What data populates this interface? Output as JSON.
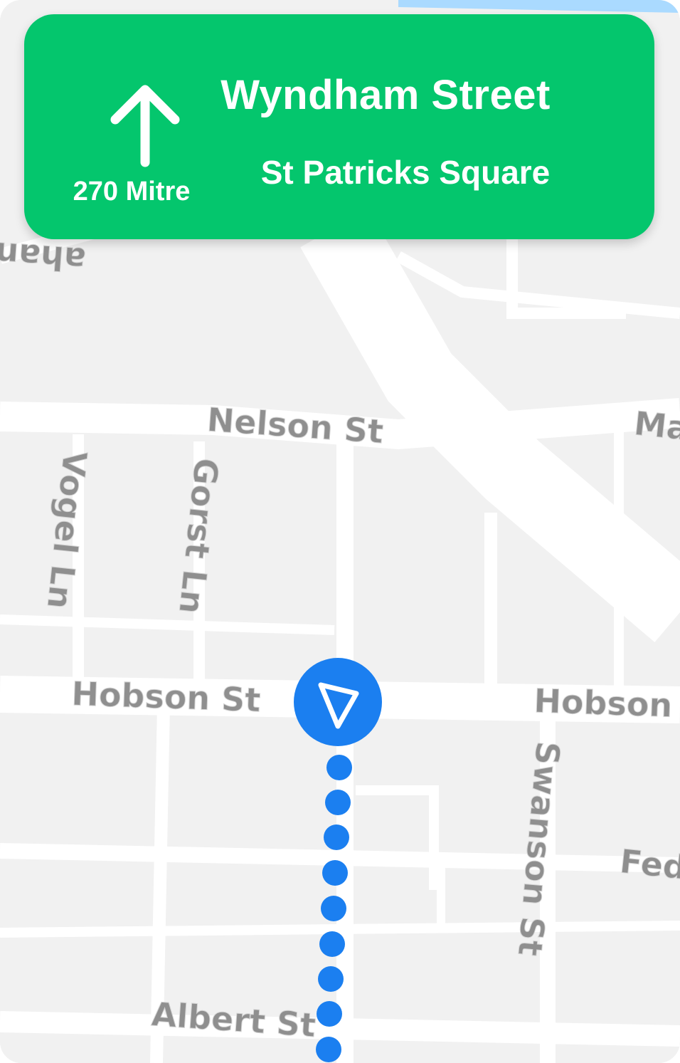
{
  "navigation": {
    "direction_icon": "arrow-up-icon",
    "distance": "270 Mitre",
    "street": "Wyndham Street",
    "landmark": "St Patricks Square",
    "card_color": "#04c66d"
  },
  "map": {
    "streets": {
      "nelson": "Nelson St",
      "vogel": "Vogel Ln",
      "gorst": "Gorst Ln",
      "hobson_left": "Hobson St",
      "hobson_right": "Hobson",
      "swanson": "Swanson St",
      "albert": "Albert St",
      "fed": "Fed",
      "top_left_partial": "ahan",
      "top_right_partial": "Ma"
    },
    "route_color": "#1b7ff0",
    "location_icon": "navigation-pointer-icon"
  }
}
